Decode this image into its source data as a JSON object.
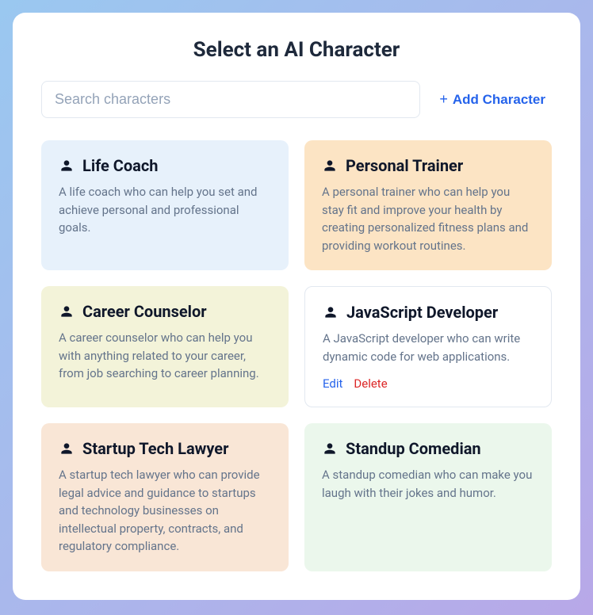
{
  "title": "Select an AI Character",
  "search": {
    "placeholder": "Search characters"
  },
  "add_button": {
    "label": "Add Character"
  },
  "actions": {
    "edit": "Edit",
    "delete": "Delete"
  },
  "characters": [
    {
      "name": "Life Coach",
      "description": "A life coach who can help you set and achieve personal and professional goals.",
      "bg": "bg-blue",
      "show_actions": false
    },
    {
      "name": "Personal Trainer",
      "description": "A personal trainer who can help you stay fit and improve your health by creating personalized fitness plans and providing workout routines.",
      "bg": "bg-orange",
      "show_actions": false
    },
    {
      "name": "Career Counselor",
      "description": "A career counselor who can help you with anything related to your career, from job searching to career planning.",
      "bg": "bg-yellow",
      "show_actions": false
    },
    {
      "name": "JavaScript Developer",
      "description": "A JavaScript developer who can write dynamic code for web applications.",
      "bg": "bg-white",
      "show_actions": true
    },
    {
      "name": "Startup Tech Lawyer",
      "description": "A startup tech lawyer who can provide legal advice and guidance to startups and technology businesses on intellectual property, contracts, and regulatory compliance.",
      "bg": "bg-peach",
      "show_actions": false
    },
    {
      "name": "Standup Comedian",
      "description": "A standup comedian who can make you laugh with their jokes and humor.",
      "bg": "bg-green",
      "show_actions": false
    }
  ]
}
